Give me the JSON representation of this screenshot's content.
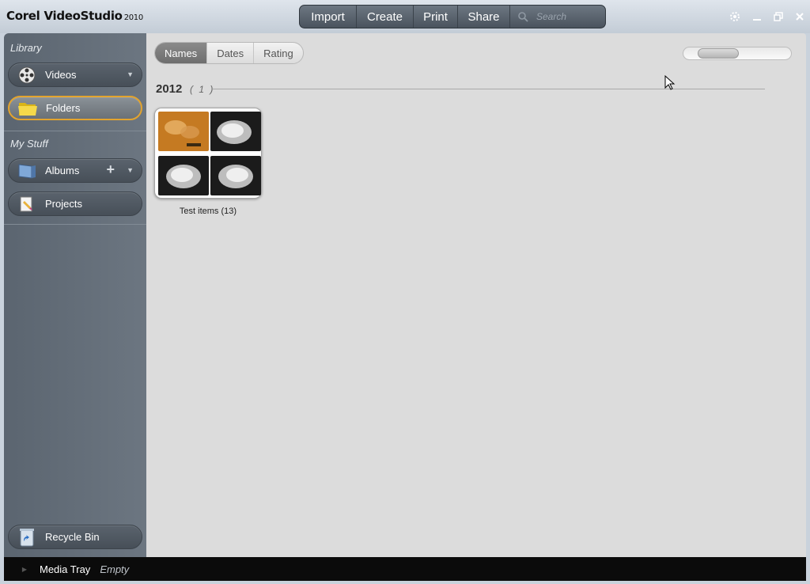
{
  "app": {
    "name": "Corel VideoStudio",
    "version": "2010"
  },
  "topnav": {
    "import": "Import",
    "create": "Create",
    "print": "Print",
    "share": "Share",
    "search_placeholder": "Search"
  },
  "sidebar": {
    "library_heading": "Library",
    "mystuff_heading": "My Stuff",
    "videos": "Videos",
    "folders": "Folders",
    "albums": "Albums",
    "projects": "Projects",
    "recycle_bin": "Recycle Bin"
  },
  "view_tabs": [
    "Names",
    "Dates",
    "Rating"
  ],
  "active_tab": "Names",
  "group": {
    "year": "2012",
    "count": "( 1 )"
  },
  "folder": {
    "label": "Test items (13)"
  },
  "tray": {
    "label": "Media Tray",
    "status": "Empty"
  },
  "colors": {
    "active_outline": "#e3a42e",
    "sidebar": "#5b6570",
    "content_bg": "#dcdcdc",
    "tray_bg": "#0b0b0b"
  }
}
